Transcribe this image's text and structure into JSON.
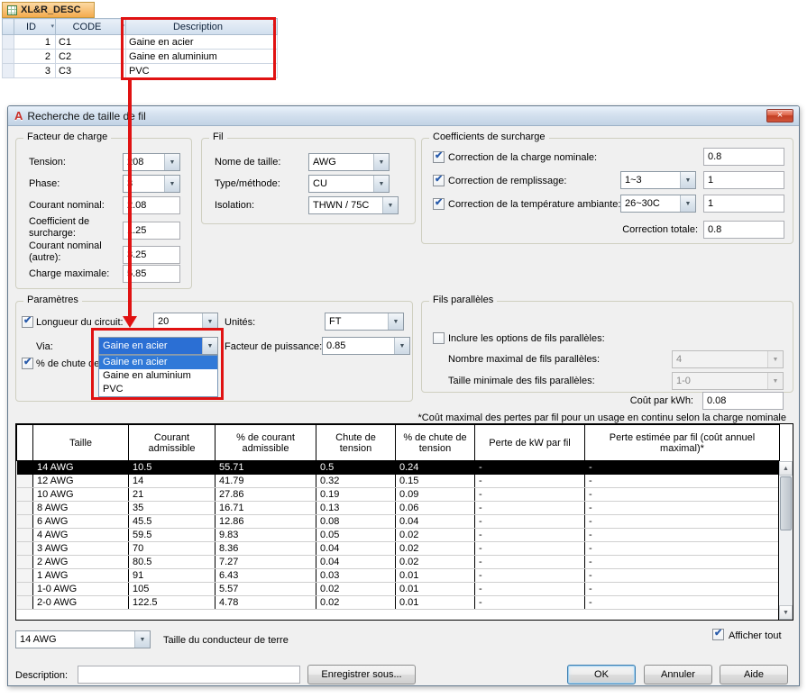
{
  "icons": {
    "dropdown": "▼",
    "filter": "▾",
    "check": "✔",
    "close": "×",
    "scroll_up": "▲",
    "scroll_down": "▼",
    "acad": "A"
  },
  "spreadsheet": {
    "tab_title": "XL&R_DESC",
    "columns": [
      "ID",
      "CODE",
      "Description"
    ],
    "rows": [
      {
        "id": "1",
        "code": "C1",
        "desc": "Gaine en acier"
      },
      {
        "id": "2",
        "code": "C2",
        "desc": "Gaine en aluminium"
      },
      {
        "id": "3",
        "code": "C3",
        "desc": "PVC"
      }
    ]
  },
  "dialog": {
    "title": "Recherche de taille de fil",
    "facteur": {
      "label": "Facteur de charge",
      "tension_label": "Tension:",
      "tension": "208",
      "phase_label": "Phase:",
      "phase": "3",
      "courant_label": "Courant nominal:",
      "courant": "2.08",
      "coeff_label": "Coefficient de surcharge:",
      "coeff": "1.25",
      "autre_label": "Courant nominal (autre):",
      "autre": "3.25",
      "charge_label": "Charge maximale:",
      "charge": "5.85"
    },
    "fil": {
      "label": "Fil",
      "nome_label": "Nome de taille:",
      "nome": "AWG",
      "type_label": "Type/méthode:",
      "type": "CU",
      "isolation_label": "Isolation:",
      "isolation": "THWN / 75C"
    },
    "coeff": {
      "label": "Coefficients de surcharge",
      "nominale_label": "Correction de la charge nominale:",
      "nominale_checked": true,
      "nominale": "0.8",
      "remplissage_label": "Correction de remplissage:",
      "remplissage_checked": true,
      "remplissage_combo": "1~3",
      "remplissage": "1",
      "temperature_label": "Correction de la température ambiante:",
      "temperature_checked": true,
      "temperature_combo": "26~30C",
      "temperature": "1",
      "totale_label": "Correction totale:",
      "totale": "0.8"
    },
    "parametres": {
      "label": "Paramètres",
      "longueur_label": "Longueur du circuit:",
      "longueur_checked": true,
      "longueur": "20",
      "unites_label": "Unités:",
      "unites": "FT",
      "via_label": "Via:",
      "via": "Gaine en acier",
      "via_options": [
        {
          "label": "Gaine en acier",
          "selected": true
        },
        {
          "label": "Gaine en aluminium"
        },
        {
          "label": "PVC"
        }
      ],
      "chute_label": "% de chute de",
      "chute_checked": true,
      "puissance_label": "Facteur de puissance:",
      "puissance": "0.85"
    },
    "fils": {
      "label": "Fils parallèles",
      "inclure_label": "Inclure les options de fils parallèles:",
      "inclure_checked": false,
      "nombre_label": "Nombre maximal de fils parallèles:",
      "nombre": "4",
      "taille_label": "Taille minimale des fils parallèles:",
      "taille": "1-0"
    },
    "cout_label": "Coût par kWh:",
    "cout": "0.08",
    "note": "*Coût maximal des pertes par fil pour un usage en continu selon la charge nominale",
    "table": {
      "headers": [
        "Taille",
        "Courant admissible",
        "% de courant admissible",
        "Chute de tension",
        "% de chute de tension",
        "Perte de kW par fil",
        "Perte estimée par fil (coût annuel maximal)*"
      ],
      "rows": [
        {
          "taille": "14 AWG",
          "courant": "10.5",
          "pct_courant": "55.71",
          "chute": "0.5",
          "pct_chute": "0.24",
          "perte_kw": "-",
          "perte_estimee": "-",
          "selected": true
        },
        {
          "taille": "12 AWG",
          "courant": "14",
          "pct_courant": "41.79",
          "chute": "0.32",
          "pct_chute": "0.15",
          "perte_kw": "-",
          "perte_estimee": "-"
        },
        {
          "taille": "10 AWG",
          "courant": "21",
          "pct_courant": "27.86",
          "chute": "0.19",
          "pct_chute": "0.09",
          "perte_kw": "-",
          "perte_estimee": "-"
        },
        {
          "taille": "8 AWG",
          "courant": "35",
          "pct_courant": "16.71",
          "chute": "0.13",
          "pct_chute": "0.06",
          "perte_kw": "-",
          "perte_estimee": "-"
        },
        {
          "taille": "6 AWG",
          "courant": "45.5",
          "pct_courant": "12.86",
          "chute": "0.08",
          "pct_chute": "0.04",
          "perte_kw": "-",
          "perte_estimee": "-"
        },
        {
          "taille": "4 AWG",
          "courant": "59.5",
          "pct_courant": "9.83",
          "chute": "0.05",
          "pct_chute": "0.02",
          "perte_kw": "-",
          "perte_estimee": "-"
        },
        {
          "taille": "3 AWG",
          "courant": "70",
          "pct_courant": "8.36",
          "chute": "0.04",
          "pct_chute": "0.02",
          "perte_kw": "-",
          "perte_estimee": "-"
        },
        {
          "taille": "2 AWG",
          "courant": "80.5",
          "pct_courant": "7.27",
          "chute": "0.04",
          "pct_chute": "0.02",
          "perte_kw": "-",
          "perte_estimee": "-"
        },
        {
          "taille": "1 AWG",
          "courant": "91",
          "pct_courant": "6.43",
          "chute": "0.03",
          "pct_chute": "0.01",
          "perte_kw": "-",
          "perte_estimee": "-"
        },
        {
          "taille": "1-0 AWG",
          "courant": "105",
          "pct_courant": "5.57",
          "chute": "0.02",
          "pct_chute": "0.01",
          "perte_kw": "-",
          "perte_estimee": "-"
        },
        {
          "taille": "2-0 AWG",
          "courant": "122.5",
          "pct_courant": "4.78",
          "chute": "0.02",
          "pct_chute": "0.01",
          "perte_kw": "-",
          "perte_estimee": "-"
        }
      ]
    },
    "terre": "14 AWG",
    "terre_label": "Taille du conducteur de terre",
    "afficher_label": "Afficher tout",
    "afficher_checked": true,
    "description_label": "Description:",
    "description_value": "",
    "buttons": {
      "enregistrer": "Enregistrer sous...",
      "ok": "OK",
      "annuler": "Annuler",
      "aide": "Aide"
    }
  }
}
